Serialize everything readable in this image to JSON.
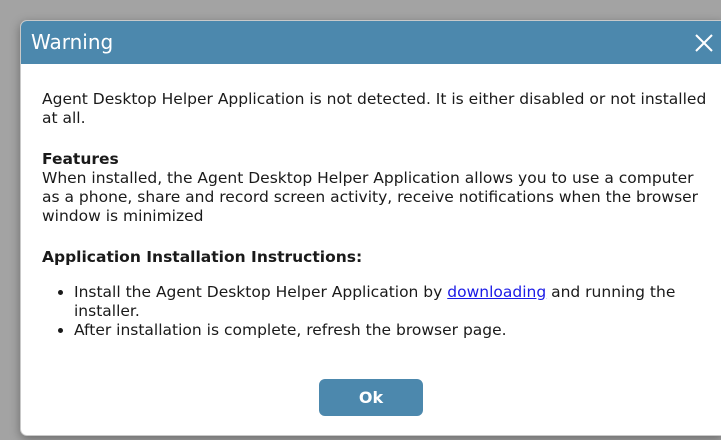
{
  "dialog": {
    "title": "Warning",
    "message": "Agent Desktop Helper Application is not detected. It is either disabled or not installed at all.",
    "features_heading": "Features",
    "features_text": "When installed, the Agent Desktop Helper Application allows you to use a computer as a phone, share and record screen activity, receive notifications when the browser window is minimized",
    "instructions_heading": "Application Installation Instructions:",
    "instructions": {
      "step1_before": "Install the Agent Desktop Helper Application by ",
      "step1_link": "downloading",
      "step1_after": " and running the installer.",
      "step2": "After installation is complete, refresh the browser page."
    },
    "ok_label": "Ok"
  },
  "icons": {
    "close": "close-icon"
  },
  "colors": {
    "accent": "#4c88ad",
    "link": "#1a1ae6",
    "backdrop": "#a3a3a3"
  }
}
